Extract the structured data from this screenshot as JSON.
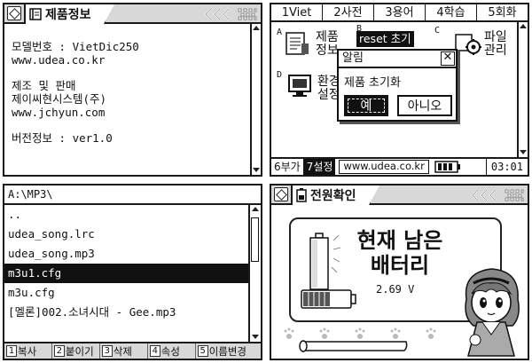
{
  "screen_info": {
    "title": "제품정보",
    "model_line": "모델번호 : VietDic250",
    "model_url": "www.udea.co.kr",
    "maker_line1": "제조 및 판매",
    "maker_line2": "제이씨현시스템(주)",
    "maker_url": "www.jchyun.com",
    "version_line": "버전정보 : ver1.0"
  },
  "screen_menu": {
    "tabs": [
      "1Viet",
      "2사전",
      "3용어",
      "4학습",
      "5회화"
    ],
    "items": [
      {
        "letter": "A",
        "label1": "제품",
        "label2": "정보"
      },
      {
        "letter": "B",
        "label1": "reset 초기",
        "label2": ""
      },
      {
        "letter": "C",
        "label1": "파일",
        "label2": "관리"
      },
      {
        "letter": "D",
        "label1": "환경",
        "label2": "설정"
      }
    ],
    "dialog": {
      "title": "알림",
      "close": "✕",
      "message": "제품 초기화",
      "yes": "예",
      "no": "아니오"
    },
    "bottom": {
      "tab6": "6부가",
      "tab7": "7설정",
      "url": "www.udea.co.kr",
      "time": "03:01"
    }
  },
  "screen_files": {
    "path": "A:\\MP3\\",
    "files": [
      "..",
      "udea_song.lrc",
      "udea_song.mp3",
      "m3u1.cfg",
      "m3u.cfg",
      "[멜론]002.소녀시대 - Gee.mp3"
    ],
    "selected_index": 3,
    "fn_keys": [
      {
        "key": "1",
        "label": "복사"
      },
      {
        "key": "2",
        "label": "붙이기"
      },
      {
        "key": "3",
        "label": "삭제"
      },
      {
        "key": "4",
        "label": "속성"
      },
      {
        "key": "5",
        "label": "이름변경"
      }
    ]
  },
  "screen_power": {
    "title": "전원확인",
    "line1": "현재 남은",
    "line2": "배터리",
    "voltage": "2.69  V"
  },
  "icons": [
    "diamond-menu-icon",
    "book-icon",
    "battery-icon",
    "arrows-icon",
    "grip-icon",
    "close-icon"
  ],
  "colors": {
    "selection": "#111111",
    "titlebar": "#d8d8d8",
    "background": "#ffffff"
  }
}
